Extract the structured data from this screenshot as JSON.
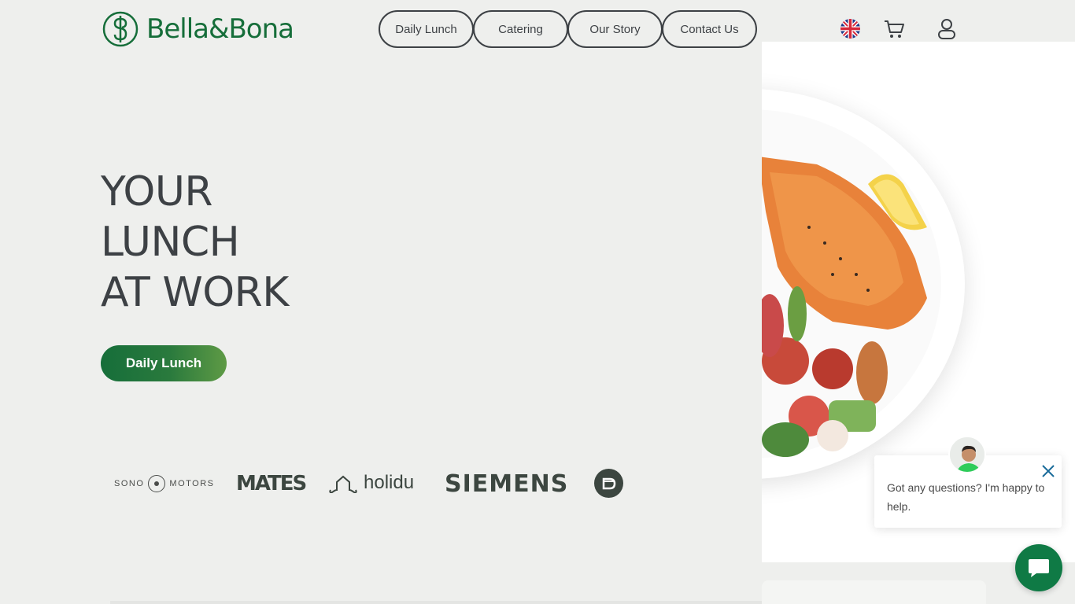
{
  "brand": {
    "name": "Bella&Bona",
    "accent": "#166e3a"
  },
  "nav": {
    "items": [
      {
        "label": "Daily Lunch"
      },
      {
        "label": "Catering"
      },
      {
        "label": "Our Story"
      },
      {
        "label": "Contact Us"
      }
    ]
  },
  "header_icons": [
    "uk-flag-icon",
    "cart-icon",
    "user-icon"
  ],
  "hero": {
    "title_lines": [
      "YOUR",
      "LUNCH",
      "AT WORK"
    ],
    "cta_label": "Daily Lunch"
  },
  "partners": {
    "sono_left": "SONO",
    "sono_right": "MOTORS",
    "mates": "MATES",
    "holidu": "holidu",
    "siemens": "SIEMENS"
  },
  "chat": {
    "message": "Got any questions? I'm happy to help."
  }
}
